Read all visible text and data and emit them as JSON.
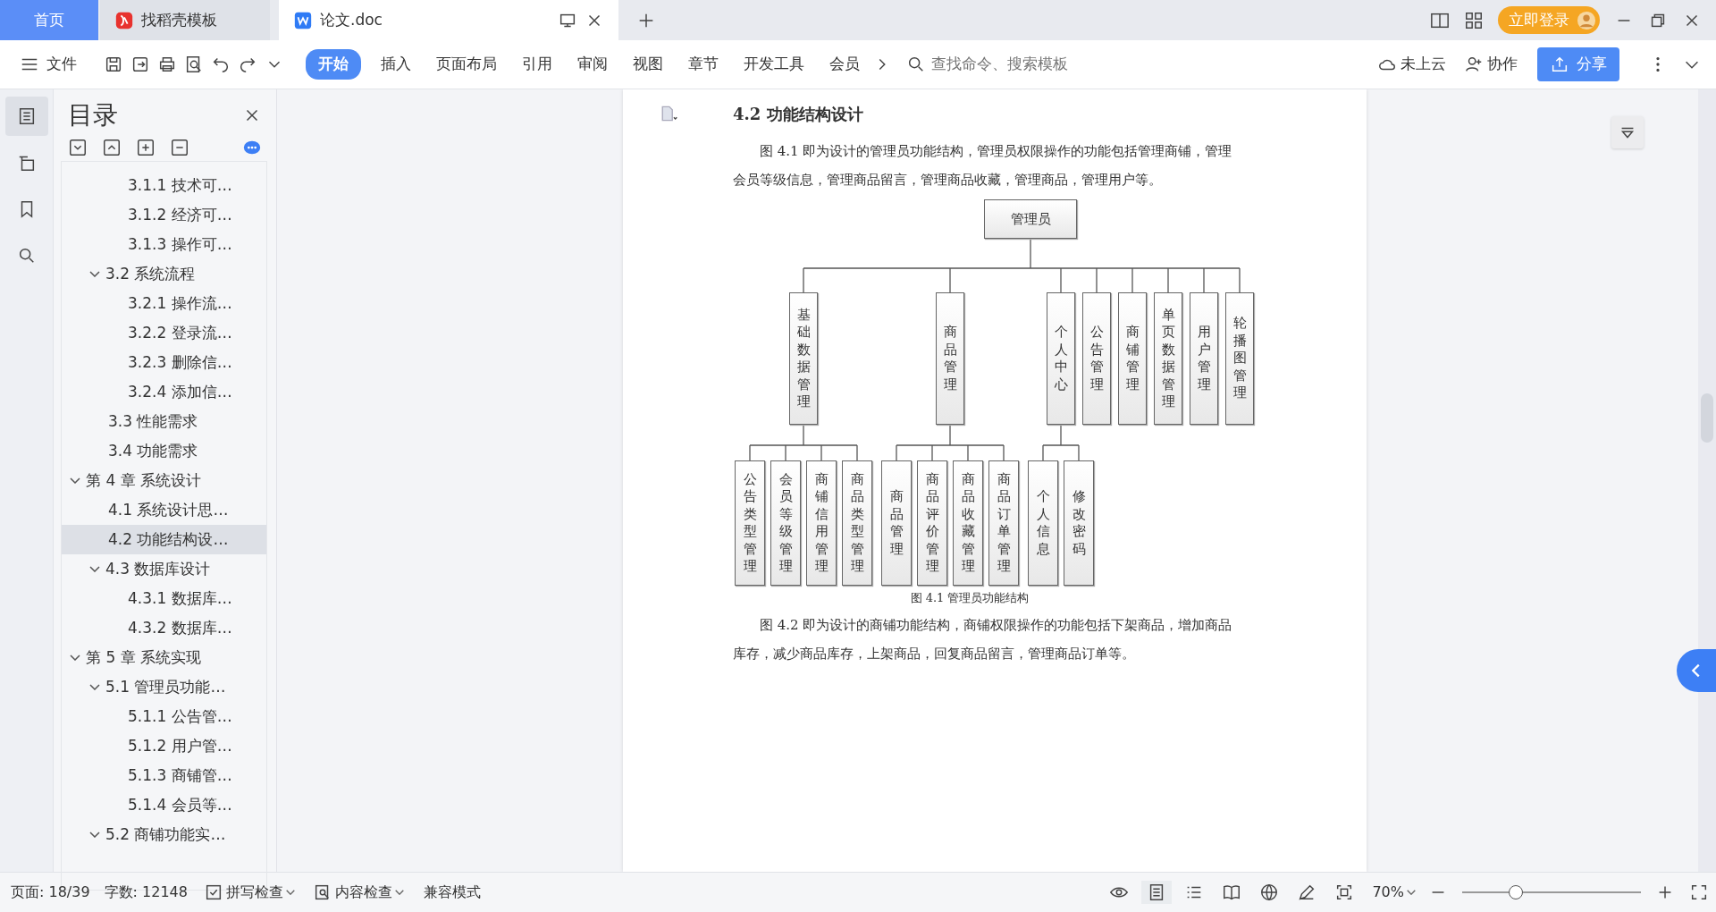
{
  "tabs": [
    {
      "label": "首页",
      "kind": "home",
      "selected": false
    },
    {
      "label": "找稻壳模板",
      "kind": "template",
      "selected": false
    },
    {
      "label": "论文.doc",
      "kind": "document",
      "selected": true
    }
  ],
  "account": {
    "login_label": "立即登录"
  },
  "toolbar": {
    "file_label": "文件",
    "menus": [
      {
        "label": "开始",
        "selected": true
      },
      {
        "label": "插入",
        "selected": false
      },
      {
        "label": "页面布局",
        "selected": false
      },
      {
        "label": "引用",
        "selected": false
      },
      {
        "label": "审阅",
        "selected": false
      },
      {
        "label": "视图",
        "selected": false
      },
      {
        "label": "章节",
        "selected": false
      },
      {
        "label": "开发工具",
        "selected": false
      },
      {
        "label": "会员",
        "selected": false
      }
    ],
    "search": {
      "placeholder": "查找命令、搜索模板"
    },
    "cloud_label": "未上云",
    "collab_label": "协作",
    "share_label": "分享"
  },
  "outline": {
    "title": "目录",
    "items": [
      {
        "children": [
          {
            "children": [
              {
                "label": "3.1.1  技术可…",
                "selected": false
              },
              {
                "label": "3.1.2  经济可…",
                "selected": false
              },
              {
                "label": "3.1.3  操作可…",
                "selected": false
              }
            ]
          },
          {
            "label": "3.2  系统流程",
            "expanded": true,
            "selected": false,
            "children": [
              {
                "label": "3.2.1  操作流…",
                "selected": false
              },
              {
                "label": "3.2.2  登录流…",
                "selected": false
              },
              {
                "label": "3.2.3  删除信…",
                "selected": false
              },
              {
                "label": "3.2.4  添加信…",
                "selected": false
              }
            ]
          },
          {
            "label": "3.3  性能需求",
            "selected": false
          },
          {
            "label": "3.4  功能需求",
            "selected": false
          }
        ]
      },
      {
        "label": "第 4 章  系统设计",
        "expanded": true,
        "selected": false,
        "children": [
          {
            "label": "4.1  系统设计思…",
            "selected": false
          },
          {
            "label": "4.2  功能结构设…",
            "selected": true
          },
          {
            "label": "4.3  数据库设计",
            "expanded": true,
            "selected": false,
            "children": [
              {
                "label": "4.3.1  数据库…",
                "selected": false
              },
              {
                "label": "4.3.2  数据库…",
                "selected": false
              }
            ]
          }
        ]
      },
      {
        "label": "第 5 章  系统实现",
        "expanded": true,
        "selected": false,
        "children": [
          {
            "label": "5.1  管理员功能…",
            "expanded": true,
            "selected": false,
            "children": [
              {
                "label": "5.1.1  公告管…",
                "selected": false
              },
              {
                "label": "5.1.2  用户管…",
                "selected": false
              },
              {
                "label": "5.1.3  商铺管…",
                "selected": false
              },
              {
                "label": "5.1.4  会员等…",
                "selected": false
              }
            ]
          },
          {
            "label": "5.2  商铺功能实…",
            "expanded": true,
            "selected": false
          }
        ]
      }
    ]
  },
  "document": {
    "heading": "4.2  功能结构设计",
    "paragraphs_before": [
      "图 4.1 即为设计的管理员功能结构，管理员权限操作的功能包括管理商铺，管理会员等级信息，管理商品留言，管理商品收藏，管理商品，管理用户等。"
    ],
    "figure": {
      "caption": "图 4.1  管理员功能结构",
      "tree": {
        "label": "管理员",
        "children": [
          {
            "label": "基础数据管理",
            "children": [
              {
                "label": "公告类型管理"
              },
              {
                "label": "会员等级管理"
              },
              {
                "label": "商铺信用管理"
              },
              {
                "label": "商品类型管理"
              }
            ]
          },
          {
            "label": "商品管理",
            "children": [
              {
                "label": "商品管理"
              },
              {
                "label": "商品评价管理"
              },
              {
                "label": "商品收藏管理"
              },
              {
                "label": "商品订单管理"
              }
            ]
          },
          {
            "label": "个人中心",
            "children": [
              {
                "label": "个人信息"
              },
              {
                "label": "修改密码"
              }
            ]
          },
          {
            "label": "公告管理"
          },
          {
            "label": "商铺管理"
          },
          {
            "label": "单页数据管理"
          },
          {
            "label": "用户管理"
          },
          {
            "label": "轮播图管理"
          }
        ]
      }
    },
    "paragraphs_after": [
      "图 4.2 即为设计的商铺功能结构，商铺权限操作的功能包括下架商品，增加商品库存，减少商品库存，上架商品，回复商品留言，管理商品订单等。"
    ]
  },
  "status_bar": {
    "page": "页面: 18/39",
    "words": "字数: 12148",
    "spell_check": "拼写检查",
    "content_check": "内容检查",
    "compat_mode": "兼容模式",
    "zoom": "70%",
    "zoom_slider": {
      "level": 0.3
    }
  }
}
